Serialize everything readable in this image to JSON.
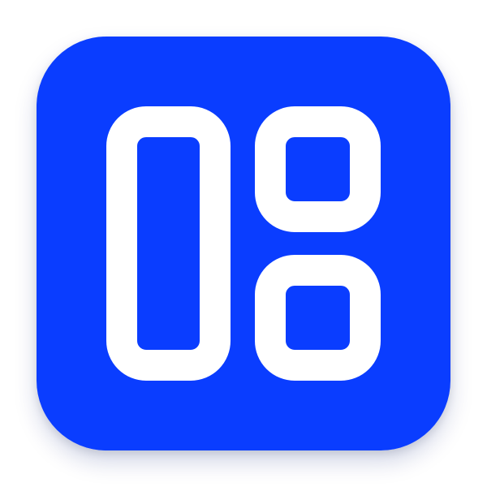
{
  "icon": {
    "name": "dashboard-layout-icon",
    "background_color": "#0a3dff",
    "glyph_color": "#ffffff"
  }
}
